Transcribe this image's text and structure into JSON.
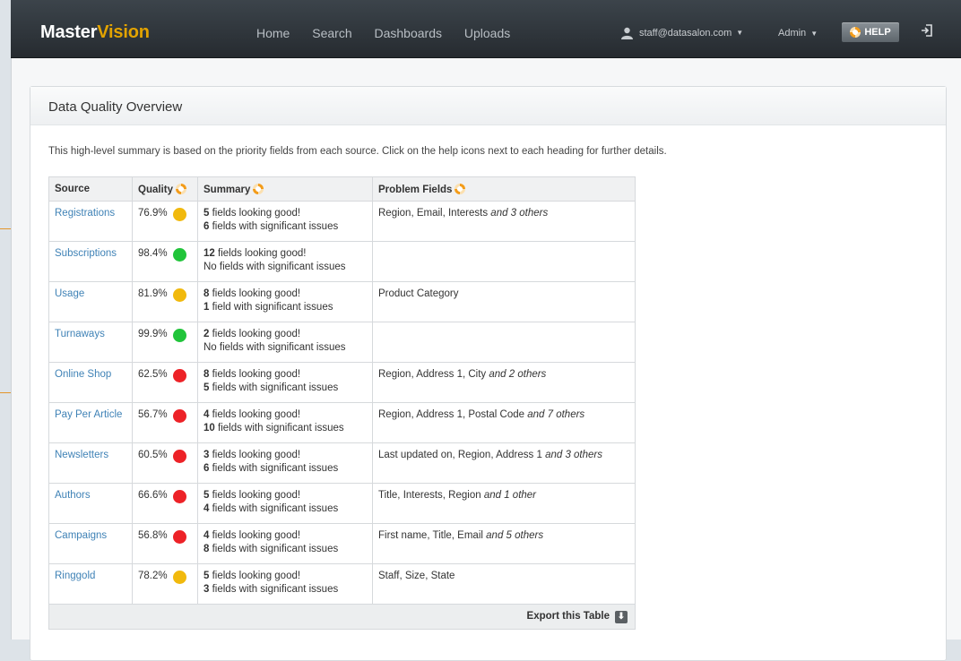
{
  "nav": {
    "brand_a": "Master",
    "brand_b": "Vision",
    "links": [
      "Home",
      "Search",
      "Dashboards",
      "Uploads"
    ],
    "user": "staff@datasalon.com",
    "admin": "Admin",
    "help": "HELP"
  },
  "panel": {
    "title": "Data Quality Overview",
    "intro": "This high-level summary is based on the priority fields from each source. Click on the help icons next to each heading for further details."
  },
  "table": {
    "headers": [
      "Source",
      "Quality",
      "Summary",
      "Problem Fields"
    ],
    "rows": [
      {
        "source": "Registrations",
        "quality": "76.9%",
        "status": "yellow",
        "good_n": "5",
        "good_t": "fields looking good!",
        "issue_n": "6",
        "issue_t": "fields with significant issues",
        "fields": "Region, Email, Interests",
        "more": "and 3 others"
      },
      {
        "source": "Subscriptions",
        "quality": "98.4%",
        "status": "green",
        "good_n": "12",
        "good_t": "fields looking good!",
        "issue_n": "",
        "issue_t": "No fields with significant issues",
        "fields": "",
        "more": ""
      },
      {
        "source": "Usage",
        "quality": "81.9%",
        "status": "yellow",
        "good_n": "8",
        "good_t": "fields looking good!",
        "issue_n": "1",
        "issue_t": "field with significant issues",
        "fields": "Product Category",
        "more": ""
      },
      {
        "source": "Turnaways",
        "quality": "99.9%",
        "status": "green",
        "good_n": "2",
        "good_t": "fields looking good!",
        "issue_n": "",
        "issue_t": "No fields with significant issues",
        "fields": "",
        "more": ""
      },
      {
        "source": "Online Shop",
        "quality": "62.5%",
        "status": "red",
        "good_n": "8",
        "good_t": "fields looking good!",
        "issue_n": "5",
        "issue_t": "fields with significant issues",
        "fields": "Region, Address 1, City",
        "more": "and 2 others"
      },
      {
        "source": "Pay Per Article",
        "quality": "56.7%",
        "status": "red",
        "good_n": "4",
        "good_t": "fields looking good!",
        "issue_n": "10",
        "issue_t": "fields with significant issues",
        "fields": "Region, Address 1, Postal Code",
        "more": "and 7 others"
      },
      {
        "source": "Newsletters",
        "quality": "60.5%",
        "status": "red",
        "good_n": "3",
        "good_t": "fields looking good!",
        "issue_n": "6",
        "issue_t": "fields with significant issues",
        "fields": "Last updated on, Region, Address 1",
        "more": "and 3 others"
      },
      {
        "source": "Authors",
        "quality": "66.6%",
        "status": "red",
        "good_n": "5",
        "good_t": "fields looking good!",
        "issue_n": "4",
        "issue_t": "fields with significant issues",
        "fields": "Title, Interests, Region",
        "more": "and 1 other"
      },
      {
        "source": "Campaigns",
        "quality": "56.8%",
        "status": "red",
        "good_n": "4",
        "good_t": "fields looking good!",
        "issue_n": "8",
        "issue_t": "fields with significant issues",
        "fields": "First name, Title, Email",
        "more": "and 5 others"
      },
      {
        "source": "Ringgold",
        "quality": "78.2%",
        "status": "yellow",
        "good_n": "5",
        "good_t": "fields looking good!",
        "issue_n": "3",
        "issue_t": "fields with significant issues",
        "fields": "Staff, Size, State",
        "more": ""
      }
    ],
    "export": "Export this Table"
  },
  "colors": {
    "yellow": "#f1b90d",
    "green": "#21c43a",
    "red": "#ed2227",
    "accent": "#e3a300"
  }
}
